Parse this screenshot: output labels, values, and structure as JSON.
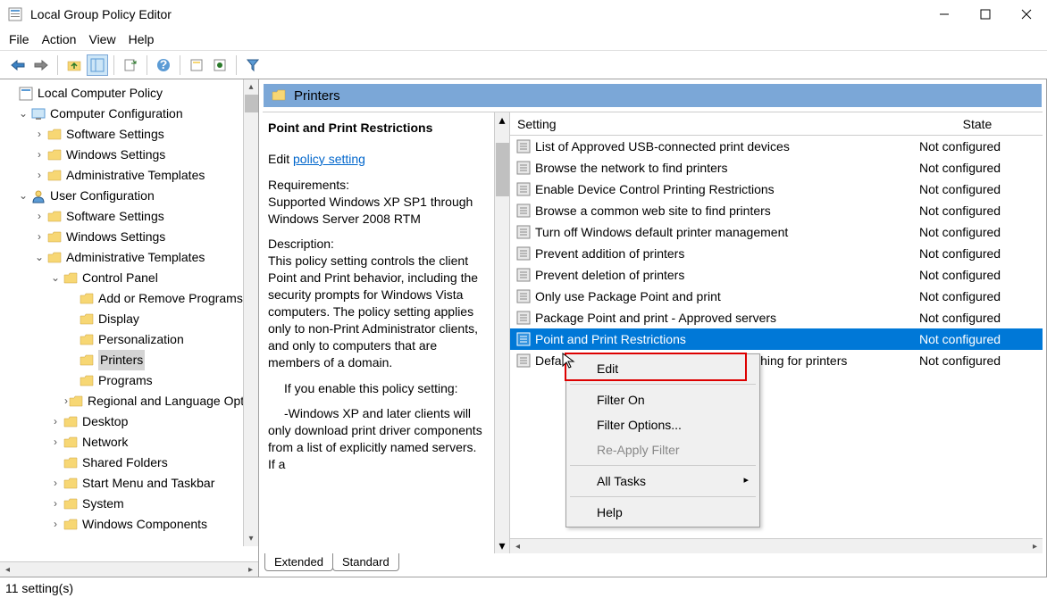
{
  "window": {
    "title": "Local Group Policy Editor"
  },
  "menubar": [
    "File",
    "Action",
    "View",
    "Help"
  ],
  "tree": {
    "root": "Local Computer Policy",
    "cc": "Computer Configuration",
    "cc_items": [
      "Software Settings",
      "Windows Settings",
      "Administrative Templates"
    ],
    "uc": "User Configuration",
    "uc_items": [
      "Software Settings",
      "Windows Settings"
    ],
    "uc_at": "Administrative Templates",
    "cp": "Control Panel",
    "cp_items": [
      "Add or Remove Programs",
      "Display",
      "Personalization",
      "Printers",
      "Programs",
      "Regional and Language Options"
    ],
    "uc_at_rest": [
      "Desktop",
      "Network",
      "Shared Folders",
      "Start Menu and Taskbar",
      "System",
      "Windows Components"
    ]
  },
  "right": {
    "header": "Printers",
    "policy_title": "Point and Print Restrictions",
    "edit_prefix": "Edit ",
    "edit_link": "policy setting",
    "req_label": "Requirements:",
    "req_text": "Supported Windows XP SP1 through Windows Server 2008 RTM",
    "desc_label": "Description:",
    "desc_text": "This policy setting controls the client Point and Print behavior, including the security prompts for Windows Vista computers. The policy setting applies only to non-Print Administrator clients, and only to computers that are members of a domain.",
    "desc_enable": "If you enable this policy setting:",
    "desc_enable_item": "-Windows XP and later clients will only download print driver components from a list of explicitly named servers. If a"
  },
  "columns": {
    "setting": "Setting",
    "state": "State"
  },
  "settings": [
    {
      "name": "List of Approved USB-connected print devices",
      "state": "Not configured"
    },
    {
      "name": "Browse the network to find printers",
      "state": "Not configured"
    },
    {
      "name": "Enable Device Control Printing Restrictions",
      "state": "Not configured"
    },
    {
      "name": "Browse a common web site to find printers",
      "state": "Not configured"
    },
    {
      "name": "Turn off Windows default printer management",
      "state": "Not configured"
    },
    {
      "name": "Prevent addition of printers",
      "state": "Not configured"
    },
    {
      "name": "Prevent deletion of printers",
      "state": "Not configured"
    },
    {
      "name": "Only use Package Point and print",
      "state": "Not configured"
    },
    {
      "name": "Package Point and print - Approved servers",
      "state": "Not configured"
    },
    {
      "name": "Point and Print Restrictions",
      "state": "Not configured",
      "selected": true
    },
    {
      "name": "Default Active Directory path when searching for printers",
      "state": "Not configured"
    }
  ],
  "tabs": [
    "Extended",
    "Standard"
  ],
  "status": "11 setting(s)",
  "context_menu": {
    "edit": "Edit",
    "filter_on": "Filter On",
    "filter_options": "Filter Options...",
    "reapply": "Re-Apply Filter",
    "all_tasks": "All Tasks",
    "help": "Help"
  }
}
